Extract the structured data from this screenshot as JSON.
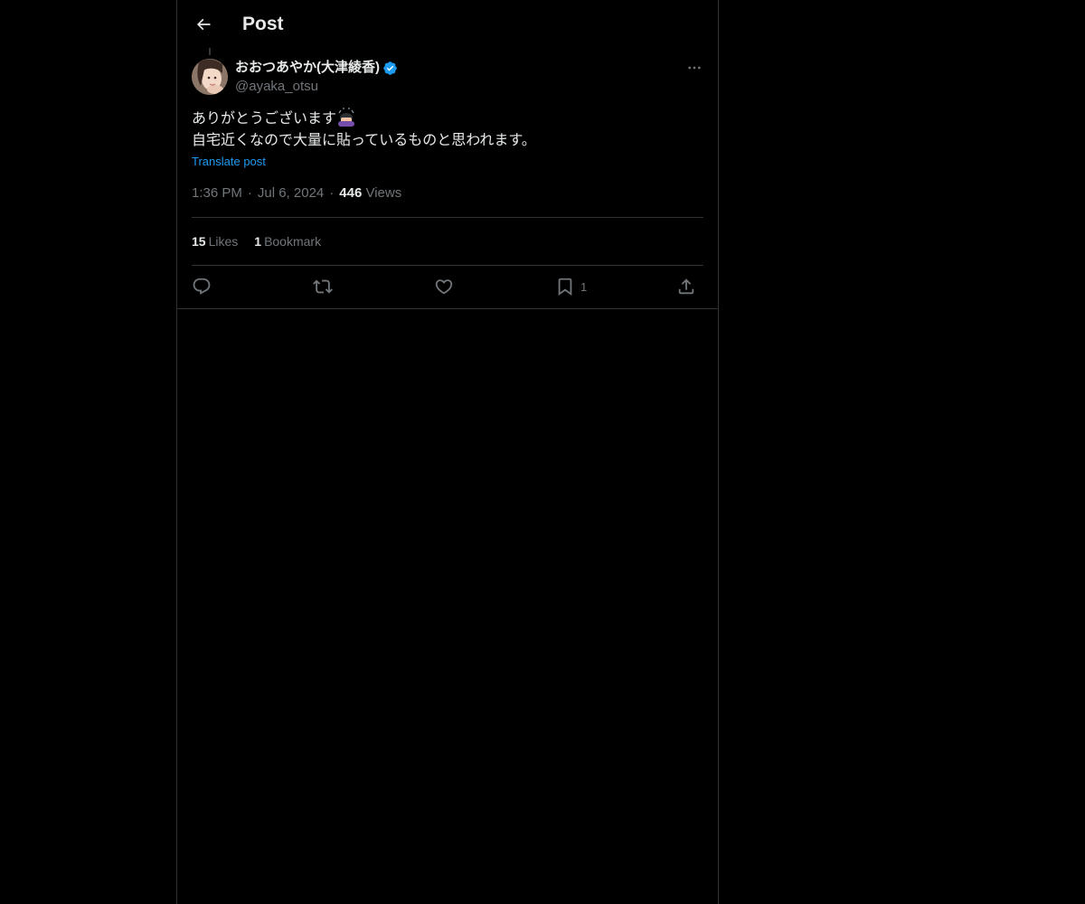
{
  "header": {
    "back_icon": "arrow-left-icon",
    "title": "Post"
  },
  "post": {
    "author": {
      "display_name": "おおつあやか(大津綾香)",
      "handle": "@ayaka_otsu",
      "verified": true,
      "verified_color": "#1d9bf0"
    },
    "text_line_1": "ありがとうございます",
    "text_emoji": "person-bowing-emoji",
    "text_line_2": "自宅近くなので大量に貼っているものと思われます。",
    "translate_label": "Translate post",
    "time": "1:36 PM",
    "separator": "·",
    "date": "Jul 6, 2024",
    "views_count": "446",
    "views_label": "Views"
  },
  "stats": {
    "likes_count": "15",
    "likes_label": "Likes",
    "bookmarks_count": "1",
    "bookmarks_label": "Bookmark"
  },
  "actions": {
    "reply_icon": "reply-icon",
    "repost_icon": "repost-icon",
    "like_icon": "heart-icon",
    "bookmark_icon": "bookmark-icon",
    "bookmark_count": "1",
    "share_icon": "share-icon"
  },
  "colors": {
    "background": "#000000",
    "text": "#e7e9ea",
    "secondary_text": "#71767b",
    "link": "#1d9bf0",
    "border": "#2f3336"
  }
}
